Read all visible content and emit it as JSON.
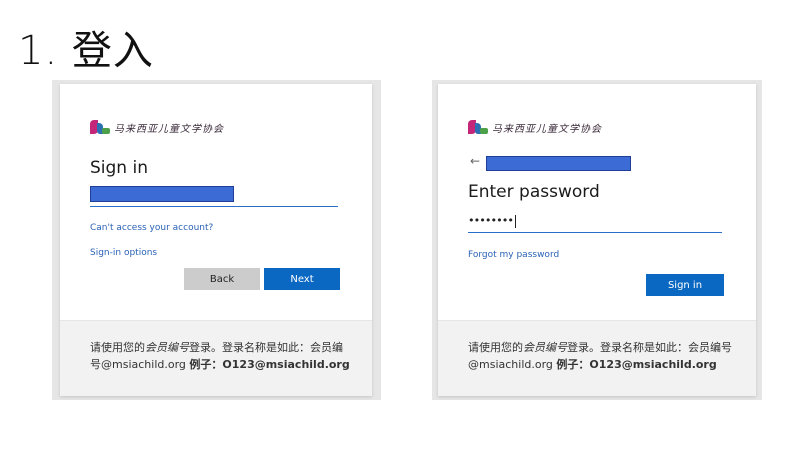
{
  "slide": {
    "title": "1. 登入"
  },
  "signin_panel": {
    "logo_text": "马来西亚儿童文学协会",
    "heading": "Sign in",
    "cant_access_link": "Can't access your account?",
    "signin_options_link": "Sign-in options",
    "back_label": "Back",
    "next_label": "Next",
    "footer": {
      "part1": "请使用您的",
      "part2": "会员编号",
      "part3": "登录。登录名称是如此：会员编号@msiachild.org",
      "part4": "例子：O123@msiachild.org"
    }
  },
  "password_panel": {
    "logo_text": "马来西亚儿童文学协会",
    "back_arrow": "←",
    "heading": "Enter password",
    "password_value": "••••••••",
    "forgot_link": "Forgot my password",
    "signin_label": "Sign in",
    "footer": {
      "part1": "请使用您的",
      "part2": "会员编号",
      "part3": "登录。登录名称是如此：会员编号@msiachild.org",
      "part4": "例子：O123@msiachild.org"
    }
  },
  "colors": {
    "primary_button": "#0b68c2",
    "secondary_button": "#cccccc",
    "link": "#2a62b5",
    "redaction": "#3d6bd6",
    "footer_bg": "#f2f2f2"
  },
  "icons": [
    "logo-mark",
    "back-arrow-icon"
  ]
}
